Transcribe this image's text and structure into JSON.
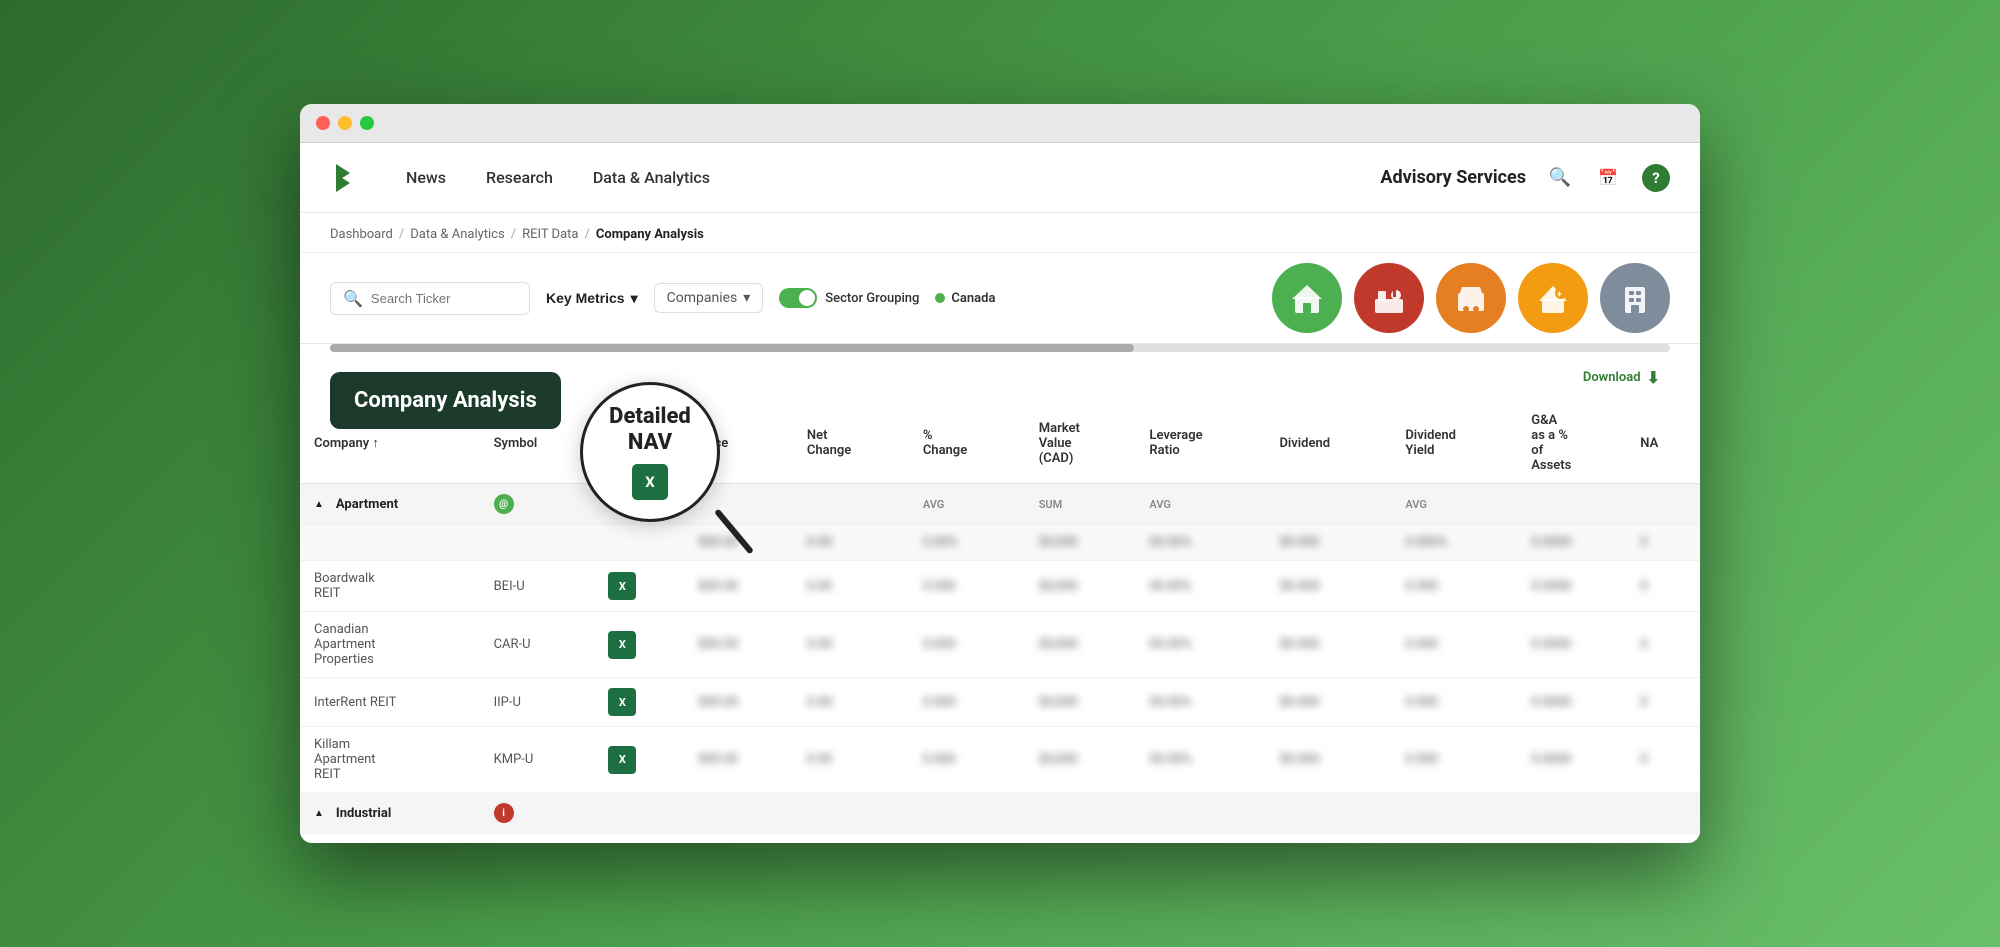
{
  "window": {
    "title": "Company Analysis"
  },
  "nav": {
    "links": [
      "News",
      "Research",
      "Data & Analytics"
    ],
    "advisory": "Advisory Services",
    "icons": [
      "search",
      "calendar",
      "help"
    ]
  },
  "breadcrumb": {
    "items": [
      "Dashboard",
      "Data & Analytics",
      "REIT Data",
      "Company Analysis"
    ]
  },
  "toolbar": {
    "search_placeholder": "Search Ticker",
    "key_metrics_label": "Key Metrics",
    "companies_label": "Companies",
    "sector_grouping_label": "Sector Grouping",
    "canada_label": "Canada",
    "download_label": "Download"
  },
  "sector_icons": [
    {
      "name": "apartment-icon",
      "color": "green",
      "symbol": "🏠"
    },
    {
      "name": "industrial-icon",
      "color": "red",
      "symbol": "🏭"
    },
    {
      "name": "retail-icon",
      "color": "orange",
      "symbol": "🛒"
    },
    {
      "name": "residential-icon",
      "color": "gold",
      "symbol": "🏡"
    },
    {
      "name": "office-icon",
      "color": "gray",
      "symbol": "🏢"
    }
  ],
  "company_analysis_label": "Company Analysis",
  "magnifier": {
    "title": "Detailed\nNAV"
  },
  "table": {
    "headers": [
      "Company ↑",
      "Symbol",
      "",
      "Price",
      "Net Change",
      "% Change",
      "Market Value (CAD)",
      "Leverage Ratio",
      "Dividend",
      "Dividend Yield",
      "G&A as a % of Assets",
      "NA"
    ],
    "aggregate_labels": [
      "AVG",
      "SUM",
      "AVG",
      "AVG"
    ],
    "sectors": [
      {
        "name": "Apartment",
        "color": "green",
        "companies": [
          {
            "name": "Boardwalk REIT",
            "symbol": "BEI-U",
            "price": "—",
            "net_change": "—",
            "pct_change": "—",
            "market_value": "—",
            "leverage": "—",
            "dividend": "—",
            "div_yield": "—",
            "gna": "—"
          },
          {
            "name": "Canadian Apartment Properties",
            "symbol": "CAR-U",
            "price": "—",
            "net_change": "—",
            "pct_change": "—",
            "market_value": "—",
            "leverage": "—",
            "dividend": "—",
            "div_yield": "—",
            "gna": "—"
          },
          {
            "name": "InterRent REIT",
            "symbol": "IIP-U",
            "price": "—",
            "net_change": "—",
            "pct_change": "—",
            "market_value": "—",
            "leverage": "—",
            "dividend": "—",
            "div_yield": "—",
            "gna": "—"
          },
          {
            "name": "Killam Apartment REIT",
            "symbol": "KMP-U",
            "price": "—",
            "net_change": "—",
            "pct_change": "—",
            "market_value": "—",
            "leverage": "—",
            "dividend": "—",
            "div_yield": "—",
            "gna": "—"
          }
        ]
      },
      {
        "name": "Industrial",
        "color": "red",
        "companies": []
      }
    ]
  }
}
